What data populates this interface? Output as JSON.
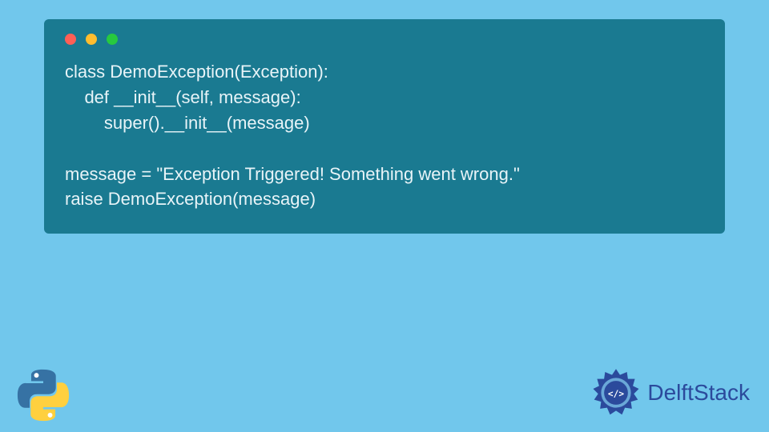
{
  "code": {
    "line1": "class DemoException(Exception):",
    "line2": "    def __init__(self, message):",
    "line3": "        super().__init__(message)",
    "line4": "",
    "line5": "message = \"Exception Triggered! Something went wrong.\"",
    "line6": "raise DemoException(message)"
  },
  "branding": {
    "name": "DelftStack"
  },
  "colors": {
    "page_bg": "#71c7ec",
    "window_bg": "#1a7a91",
    "code_text": "#e8f4f8",
    "brand_blue": "#2b4a9c"
  }
}
